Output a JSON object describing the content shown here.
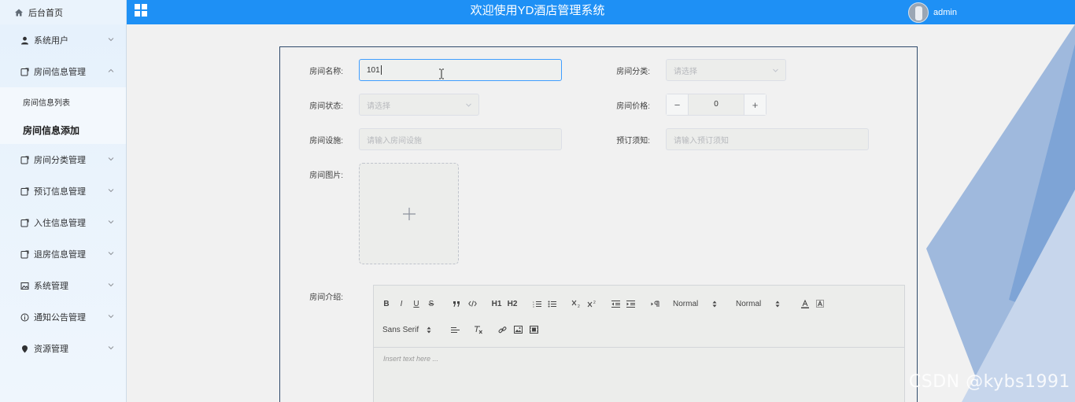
{
  "header": {
    "brand": "后台首页",
    "title": "欢迎使用YD酒店管理系统",
    "username": "admin"
  },
  "sidebar": {
    "items": [
      {
        "label": "系统用户"
      },
      {
        "label": "房间信息管理",
        "expanded": true,
        "children": [
          {
            "label": "房间信息列表"
          },
          {
            "label": "房间信息添加",
            "active": true
          }
        ]
      },
      {
        "label": "房间分类管理"
      },
      {
        "label": "预订信息管理"
      },
      {
        "label": "入住信息管理"
      },
      {
        "label": "退房信息管理"
      },
      {
        "label": "系统管理"
      },
      {
        "label": "通知公告管理"
      },
      {
        "label": "资源管理"
      }
    ]
  },
  "form": {
    "room_name": {
      "label": "房间名称:",
      "value": "101"
    },
    "room_category": {
      "label": "房间分类:",
      "placeholder": "请选择"
    },
    "room_status": {
      "label": "房间状态:",
      "placeholder": "请选择"
    },
    "room_price": {
      "label": "房间价格:",
      "value": "0",
      "minus": "−",
      "plus": "+"
    },
    "room_facilities": {
      "label": "房间设施:",
      "placeholder": "请输入房间设施"
    },
    "booking_notice": {
      "label": "预订须知:",
      "placeholder": "请输入预订须知"
    },
    "room_image": {
      "label": "房间图片:"
    },
    "room_intro": {
      "label": "房间介绍:"
    }
  },
  "editor": {
    "bold": "B",
    "italic": "I",
    "underline": "U",
    "strike": "S",
    "h1": "H1",
    "h2": "H2",
    "size_select": "Normal",
    "header_select": "Normal",
    "font_select": "Sans Serif",
    "placeholder": "Insert text here ..."
  },
  "watermark": "CSDN @kybs1991",
  "colors": {
    "header_blue": "#1e90f5",
    "active_border": "#409eff"
  }
}
